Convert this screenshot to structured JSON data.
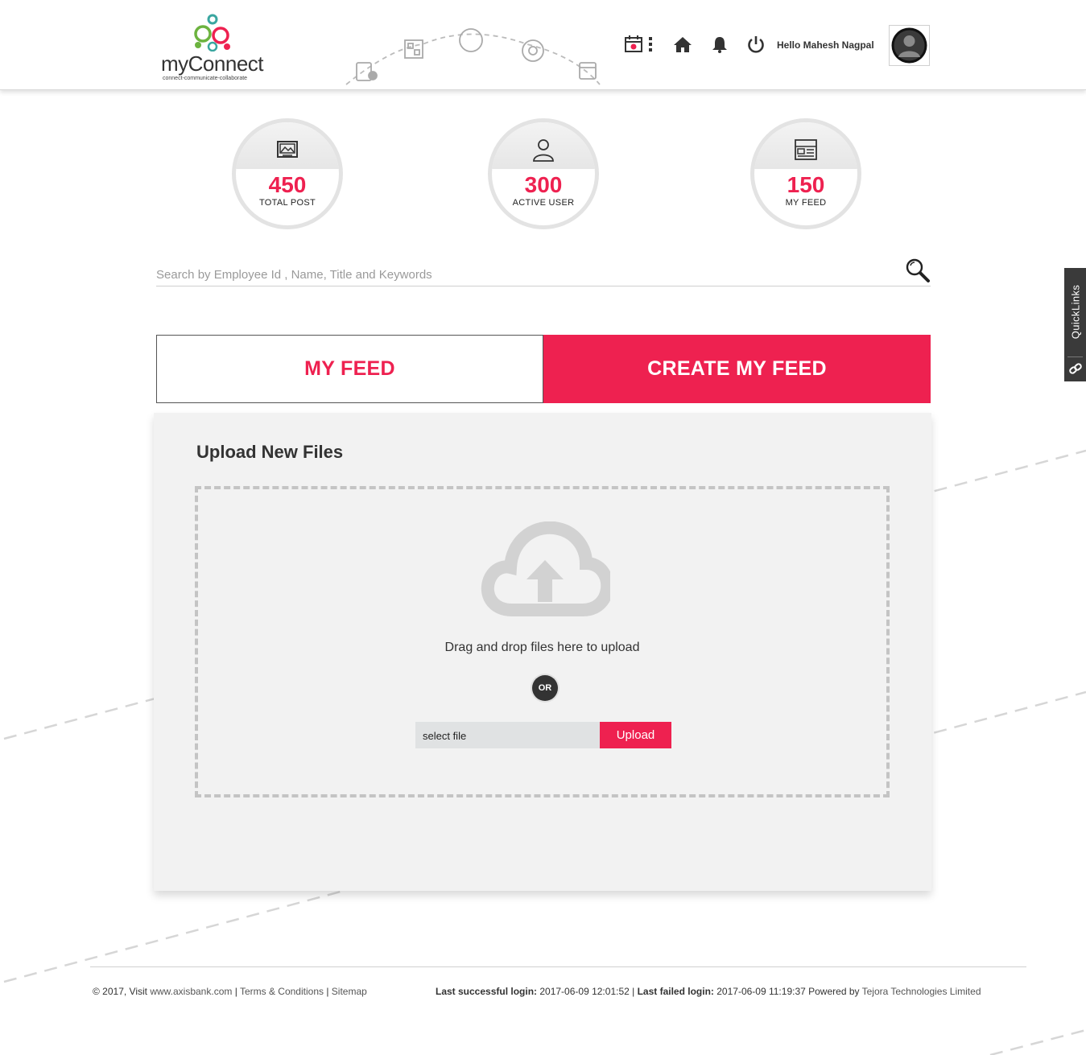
{
  "brand": {
    "name": "myConnect",
    "tagline": "connect-communicate-collaborate",
    "accent": "#ee2150"
  },
  "header": {
    "greeting": "Hello Mahesh Nagpal",
    "icons": [
      "calendar-icon",
      "more-icon",
      "home-icon",
      "bell-icon",
      "power-icon"
    ]
  },
  "stats": [
    {
      "value": "450",
      "label": "TOTAL POST",
      "icon": "image-icon"
    },
    {
      "value": "300",
      "label": "ACTIVE USER",
      "icon": "user-icon"
    },
    {
      "value": "150",
      "label": "MY FEED",
      "icon": "feed-icon"
    }
  ],
  "search": {
    "placeholder": "Search by Employee Id , Name, Title and Keywords"
  },
  "tabs": {
    "my_feed": "MY FEED",
    "create_feed": "CREATE MY FEED"
  },
  "upload": {
    "title": "Upload New Files",
    "drop_text": "Drag and drop files here to upload",
    "or_label": "OR",
    "file_placeholder": "select file",
    "button": "Upload"
  },
  "quicklinks": {
    "label": "QuickLinks"
  },
  "footer": {
    "copyright": "© 2017, Visit ",
    "site": "www.axisbank.com",
    "sep": " | ",
    "terms": "Terms & Conditions",
    "sitemap": "Sitemap",
    "last_success_label": "Last successful login:",
    "last_success_value": " 2017-06-09 12:01:52 | ",
    "last_failed_label": "Last failed login:",
    "last_failed_value": " 2017-06-09 11:19:37  Powered by ",
    "powered_by": "Tejora Technologies Limited"
  }
}
